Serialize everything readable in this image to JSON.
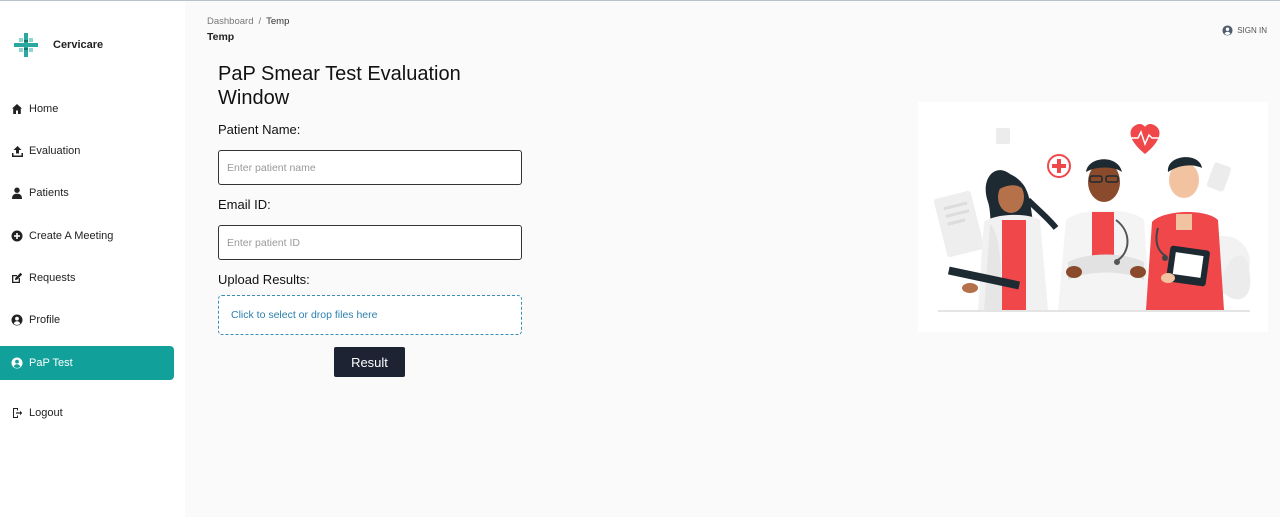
{
  "brand": {
    "name": "Cervicare"
  },
  "sidebar": {
    "items": [
      {
        "label": "Home",
        "icon": "home-icon"
      },
      {
        "label": "Evaluation",
        "icon": "upload-icon"
      },
      {
        "label": "Patients",
        "icon": "person-icon"
      },
      {
        "label": "Create A Meeting",
        "icon": "plus-circle-icon"
      },
      {
        "label": "Requests",
        "icon": "edit-icon"
      },
      {
        "label": "Profile",
        "icon": "user-circle-icon"
      },
      {
        "label": "PaP Test",
        "icon": "user-circle-icon",
        "active": true
      },
      {
        "label": "Logout",
        "icon": "logout-icon"
      }
    ]
  },
  "header": {
    "breadcrumb": [
      "Dashboard",
      "Temp"
    ],
    "page_title": "Temp",
    "signin_label": "SIGN IN"
  },
  "form": {
    "title": "PaP Smear Test Evaluation Window",
    "patient_name_label": "Patient Name:",
    "patient_name_placeholder": "Enter patient name",
    "email_label": "Email ID:",
    "email_placeholder": "Enter patient ID",
    "upload_label": "Upload Results:",
    "upload_hint": "Click to select or drop files here",
    "result_button": "Result"
  },
  "colors": {
    "accent": "#12a19a",
    "button_dark": "#1d2333",
    "illustration_red": "#f0474b"
  }
}
